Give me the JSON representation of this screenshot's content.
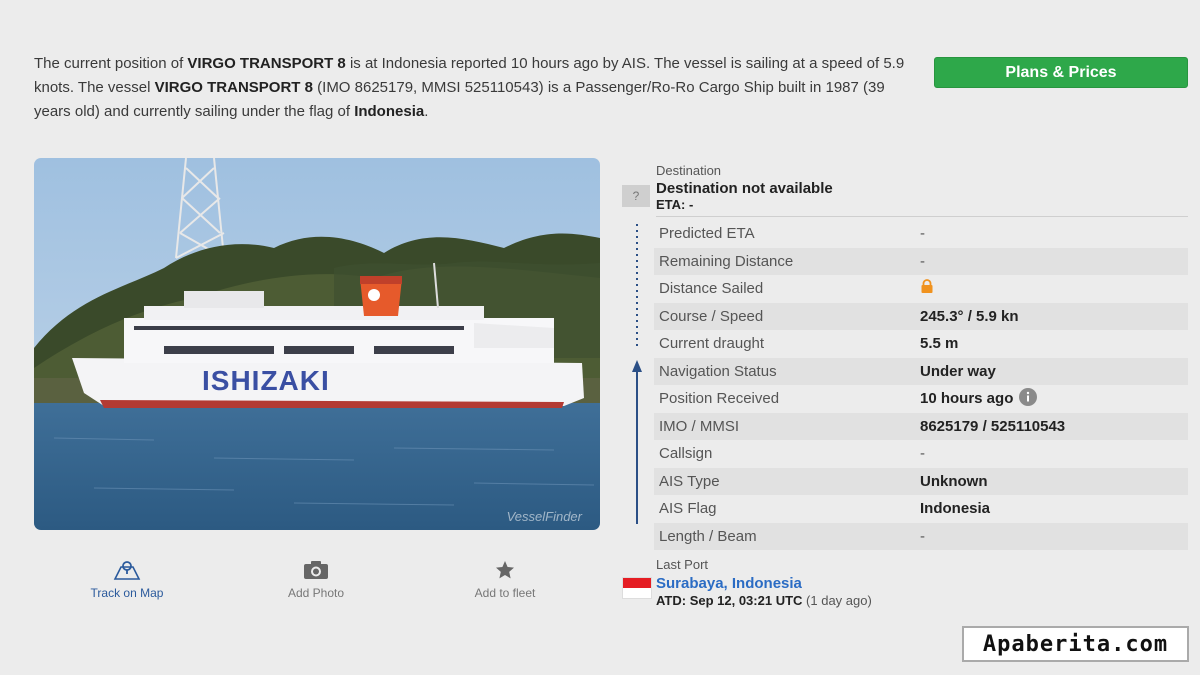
{
  "intro": {
    "p1": "The current position of ",
    "name1": "VIRGO TRANSPORT 8",
    "p2": " is at Indonesia reported 10 hours ago by AIS. The vessel is sailing at a speed of 5.9 knots. The vessel ",
    "name2": "VIRGO TRANSPORT 8",
    "p3": " (IMO 8625179, MMSI 525110543) is a Passenger/Ro-Ro Cargo Ship built in 1987 (39 years old) and currently sailing under the flag of ",
    "flag": "Indonesia",
    "p4": "."
  },
  "plans_button": "Plans & Prices",
  "photo": {
    "hull_text": "ISHIZAKI",
    "watermark": "VesselFinder"
  },
  "actions": {
    "track": "Track on Map",
    "photo": "Add Photo",
    "fleet": "Add to fleet"
  },
  "destination": {
    "heading": "Destination",
    "unknown_icon": "?",
    "name": "Destination not available",
    "eta": "ETA: -"
  },
  "details": [
    {
      "key": "Predicted ETA",
      "value": "-"
    },
    {
      "key": "Remaining Distance",
      "value": "-"
    },
    {
      "key": "Distance Sailed",
      "value": "",
      "icon": "lock-icon"
    },
    {
      "key": "Course / Speed",
      "value": "245.3° / 5.9 kn"
    },
    {
      "key": "Current draught",
      "value": "5.5 m"
    },
    {
      "key": "Navigation Status",
      "value": "Under way"
    },
    {
      "key": "Position Received",
      "value": "10 hours ago",
      "icon": "info-icon"
    },
    {
      "key": "IMO / MMSI",
      "value": "8625179 / 525110543"
    },
    {
      "key": "Callsign",
      "value": "-"
    },
    {
      "key": "AIS Type",
      "value": "Unknown"
    },
    {
      "key": "AIS Flag",
      "value": "Indonesia"
    },
    {
      "key": "Length / Beam",
      "value": "-"
    }
  ],
  "last_port": {
    "heading": "Last Port",
    "name": "Surabaya, Indonesia",
    "atd": "ATD: Sep 12, 03:21 UTC",
    "ago": "(1 day ago)"
  },
  "brand": "Apaberita.com",
  "colors": {
    "accent_green": "#2ea84a",
    "link_blue": "#2b6cc4",
    "lock_orange": "#f0921e",
    "flag_red": "#e51d23"
  }
}
